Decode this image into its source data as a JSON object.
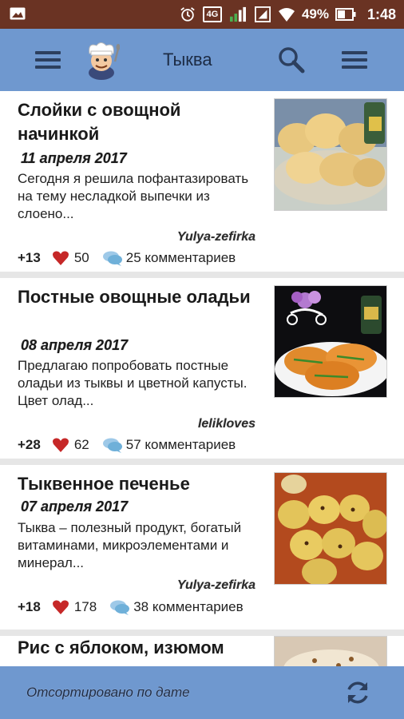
{
  "status_bar": {
    "network": "4G",
    "battery": "49%",
    "time": "1:48",
    "icons": [
      "image-icon",
      "alarm-icon",
      "network-4g-icon",
      "signal-icon",
      "signal-2-icon",
      "wifi-icon",
      "battery-icon"
    ]
  },
  "app_bar": {
    "title": "Тыква",
    "icons": [
      "menu-icon",
      "chef-logo",
      "search-icon",
      "more-menu-icon"
    ]
  },
  "posts": [
    {
      "title": "Слойки с овощной начинкой",
      "date": "11 апреля 2017",
      "excerpt": "Сегодня я решила пофантазировать на тему несладкой выпечки из слоено...",
      "author": "Yulya-zefirka",
      "rating": "+13",
      "likes": "50",
      "comments": "25 комментариев",
      "thumb": "puff-pastry-photo"
    },
    {
      "title": "Постные овощные оладьи",
      "date": "08 апреля 2017",
      "excerpt": "Предлагаю попробовать постные оладьи из тыквы и цветной капусты. Цвет олад...",
      "author": "lelikloves",
      "rating": "+28",
      "likes": "62",
      "comments": "57 комментариев",
      "thumb": "pancakes-photo"
    },
    {
      "title": "Тыквенное печенье",
      "date": "07 апреля 2017",
      "excerpt": "Тыква – полезный продукт, богатый витаминами, микроэлементами и минерал...",
      "author": "Yulya-zefirka",
      "rating": "+18",
      "likes": "178",
      "comments": "38 комментариев",
      "thumb": "cookies-photo"
    },
    {
      "title": "Рис с яблоком, изюмом",
      "thumb": "rice-photo"
    }
  ],
  "bottom_bar": {
    "sort_label": "Отсортировано по дате",
    "icon": "refresh-icon"
  },
  "colors": {
    "status_bar": "#6a3323",
    "app_bar": "#6f98cf",
    "heart": "#c62828",
    "divider": "#e6e6e6"
  }
}
